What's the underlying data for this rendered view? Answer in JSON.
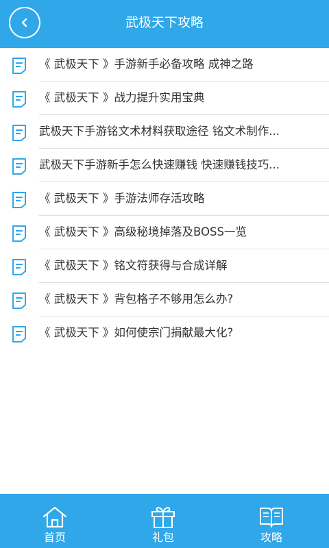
{
  "header": {
    "title": "武极天下攻略"
  },
  "list": {
    "items": [
      {
        "label": "《 武极天下 》手游新手必备攻略 成神之路"
      },
      {
        "label": "《 武极天下 》战力提升实用宝典"
      },
      {
        "label": "武极天下手游铭文术材料获取途径 铭文术制作..."
      },
      {
        "label": "武极天下手游新手怎么快速赚钱 快速赚钱技巧..."
      },
      {
        "label": "《 武极天下 》手游法师存活攻略"
      },
      {
        "label": "《 武极天下 》高级秘境掉落及BOSS一览"
      },
      {
        "label": "《 武极天下 》铭文符获得与合成详解"
      },
      {
        "label": "《 武极天下 》背包格子不够用怎么办?"
      },
      {
        "label": "《 武极天下 》如何使宗门捐献最大化?"
      }
    ]
  },
  "tabbar": {
    "home_label": "首页",
    "gift_label": "礼包",
    "guide_label": "攻略"
  },
  "icons": {
    "back": "chevron-left-icon",
    "list_item": "document-icon",
    "home": "house-icon",
    "gift": "gift-icon",
    "guide": "book-icon"
  },
  "colors": {
    "primary": "#2fa7e8",
    "text": "#333333",
    "divider": "#dedede"
  }
}
